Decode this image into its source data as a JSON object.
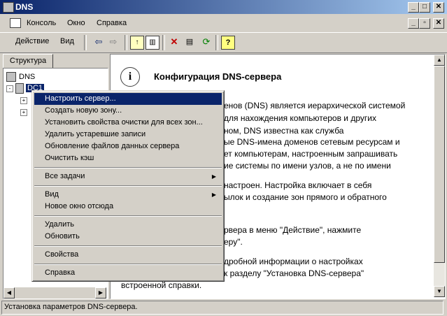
{
  "window": {
    "title": "DNS"
  },
  "menubar": {
    "items": [
      "Консоль",
      "Окно",
      "Справка"
    ]
  },
  "toolbar": {
    "action_label": "Действие",
    "view_label": "Вид"
  },
  "left_pane": {
    "tab_label": "Структура",
    "tree": {
      "root": "DNS",
      "server": "DC1"
    }
  },
  "right_pane": {
    "title": "Конфигурация DNS-сервера",
    "lines": [
      "енов (DNS) является иерархической системой",
      "для нахождения компьютеров и других",
      "ном, DNS известна как служба",
      "ые DNS-имена доменов сетевым ресурсам и",
      "ет компьютерам, настроенным запрашивать",
      "ие системы по имени узлов, а не по имени",
      "настроен. Настройка включает в себя",
      "ылок и создание зон прямого и обратного",
      "",
      "рвера в меню \"Действие\", нажмите",
      "еру\".",
      "дробной информации о настройках",
      "к разделу \"Установка DNS-сервера\"",
      "встроенной справки."
    ]
  },
  "context_menu": {
    "items": [
      "Настроить сервер...",
      "Создать новую зону...",
      "Установить свойства очистки для всех зон...",
      "Удалить устаревшие записи",
      "Обновление файлов данных сервера",
      "Очистить кэш",
      "Все задачи",
      "Вид",
      "Новое окно отсюда",
      "Удалить",
      "Обновить",
      "Свойства",
      "Справка"
    ]
  },
  "status_bar": {
    "text": "Установка параметров DNS-сервера."
  }
}
